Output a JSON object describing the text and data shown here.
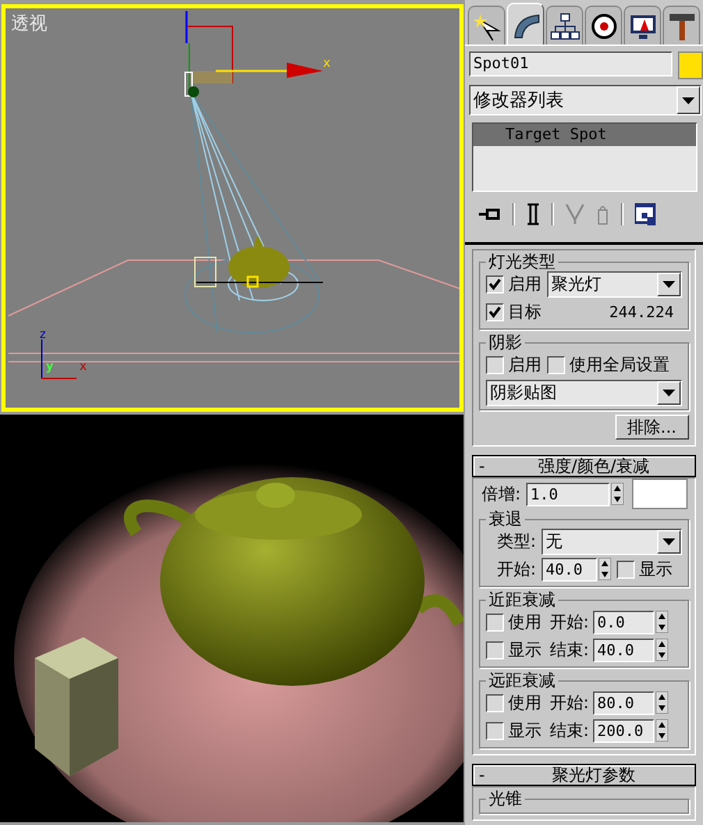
{
  "viewport": {
    "label": "透视",
    "gizmo_axis": "x",
    "tripod_axes": [
      "z",
      "y",
      "x"
    ]
  },
  "command_panel": {
    "tabs": [
      {
        "kind": "create",
        "selected": false
      },
      {
        "kind": "modify",
        "selected": true
      },
      {
        "kind": "hierarchy",
        "selected": false
      },
      {
        "kind": "motion",
        "selected": false
      },
      {
        "kind": "display",
        "selected": false
      },
      {
        "kind": "utilities",
        "selected": false
      }
    ],
    "object_name": {
      "value": "Spot01",
      "color": "#ffe000"
    },
    "modifier_list": {
      "value": "修改器列表"
    },
    "stack": [
      {
        "label": "Target Spot",
        "selected": true
      }
    ],
    "rollouts": [
      {
        "items": [
          {
            "kind": "group",
            "title": "灯光类型",
            "rows": [
              {
                "kind": "check_dropdown",
                "checked": true,
                "label": "启用",
                "value": "聚光灯"
              },
              {
                "kind": "check_value",
                "checked": true,
                "label": "目标",
                "value": "244.224"
              }
            ]
          },
          {
            "kind": "group",
            "title": "阴影",
            "rows": [
              {
                "kind": "checks",
                "items": [
                  {
                    "label": "启用",
                    "checked": false
                  },
                  {
                    "label": "使用全局设置",
                    "checked": false
                  }
                ]
              },
              {
                "kind": "dropdown",
                "value": "阴影贴图"
              }
            ]
          },
          {
            "kind": "button",
            "label": "排除..."
          }
        ]
      },
      {
        "sign": "-",
        "title": "强度/颜色/衰减",
        "items": [
          {
            "kind": "spinner_color",
            "label": "倍增:",
            "value": "1.0",
            "color": "#ffffff"
          },
          {
            "kind": "group",
            "title": "衰退",
            "rows": [
              {
                "kind": "label_dropdown",
                "label": "类型:",
                "value": "无"
              },
              {
                "kind": "spinner_check",
                "label": "开始:",
                "value": "40.0",
                "check": {
                  "label": "显示",
                  "checked": false
                }
              }
            ]
          },
          {
            "kind": "group",
            "title": "近距衰减",
            "rows": [
              {
                "kind": "check_spinner",
                "check": {
                  "label": "使用",
                  "checked": false
                },
                "label": "开始:",
                "value": "0.0"
              },
              {
                "kind": "check_spinner",
                "check": {
                  "label": "显示",
                  "checked": false
                },
                "label": "结束:",
                "value": "40.0"
              }
            ]
          },
          {
            "kind": "group",
            "title": "远距衰减",
            "rows": [
              {
                "kind": "check_spinner",
                "check": {
                  "label": "使用",
                  "checked": false
                },
                "label": "开始:",
                "value": "80.0"
              },
              {
                "kind": "check_spinner",
                "check": {
                  "label": "显示",
                  "checked": false
                },
                "label": "结束:",
                "value": "200.0"
              }
            ]
          }
        ]
      },
      {
        "sign": "-",
        "title": "聚光灯参数",
        "items": [
          {
            "kind": "group",
            "title": "光锥"
          }
        ]
      }
    ]
  }
}
